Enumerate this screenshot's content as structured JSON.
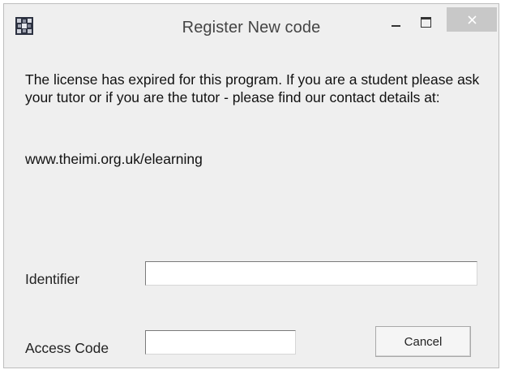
{
  "window": {
    "title": "Register New code",
    "icon": "app-icon",
    "controls": {
      "minimize_icon": "minimize-icon",
      "maximize_icon": "maximize-icon",
      "close_icon": "close-icon",
      "close_bg": "#c8c8c8"
    }
  },
  "body": {
    "message": "The license has expired for this program. If you are a student please ask your tutor or if you are the tutor - please find our contact details at:",
    "url": "www.theimi.org.uk/elearning"
  },
  "form": {
    "identifier_label": "Identifier",
    "identifier_value": "",
    "access_code_label": "Access Code",
    "access_code_value": ""
  },
  "buttons": {
    "cancel_label": "Cancel"
  }
}
